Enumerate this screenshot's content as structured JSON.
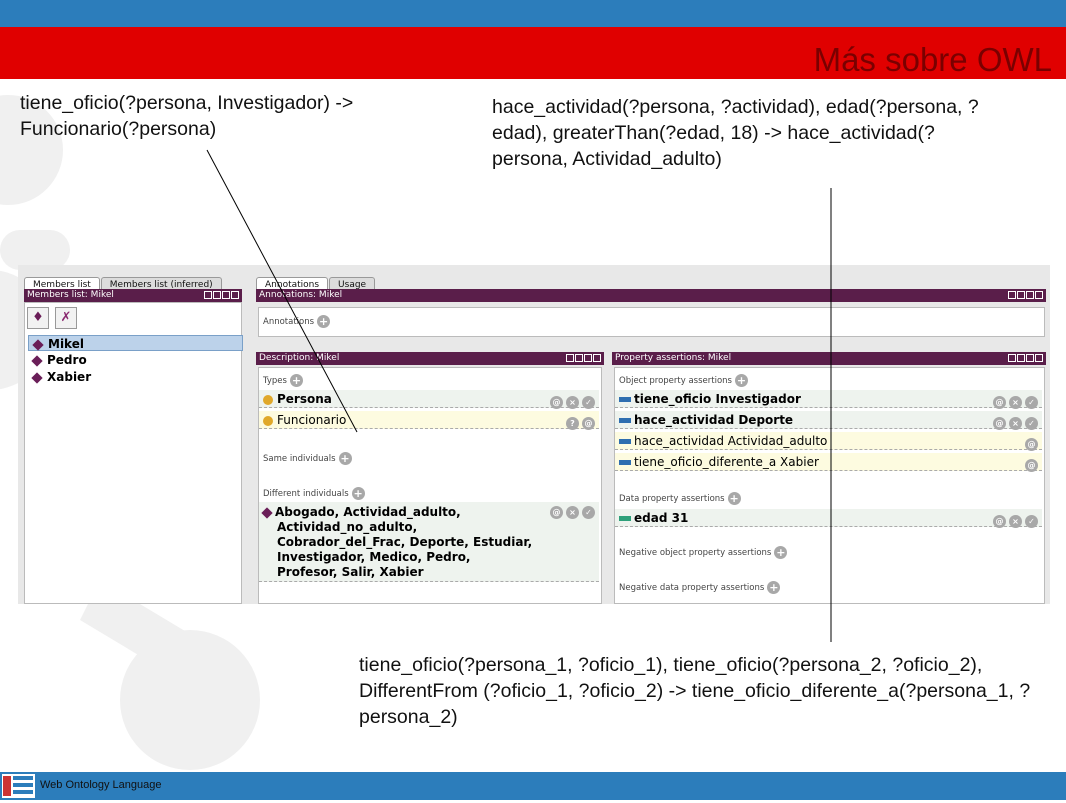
{
  "slide": {
    "title": "Más sobre OWL",
    "footer_text": "Web Ontology Language",
    "annotation_top_left": "tiene_oficio(?persona, Investigador) -> Funcionario(?persona)",
    "annotation_top_right": "hace_actividad(?persona, ?actividad), edad(?persona, ?edad), greaterThan(?edad, 18) -> hace_actividad(?persona, Actividad_adulto)",
    "annotation_bottom": "tiene_oficio(?persona_1, ?oficio_1), tiene_oficio(?persona_2, ?oficio_2),  DifferentFrom (?oficio_1, ?oficio_2) -> tiene_oficio_diferente_a(?persona_1, ?persona_2)"
  },
  "members": {
    "tabs": [
      "Members list",
      "Members list (inferred)"
    ],
    "header": "Members list: Mikel",
    "individuals": [
      "Mikel",
      "Pedro",
      "Xabier"
    ]
  },
  "annotations": {
    "tabs": [
      "Annotations",
      "Usage"
    ],
    "header": "Annotations: Mikel",
    "label": "Annotations"
  },
  "description": {
    "header": "Description: Mikel",
    "types_label": "Types",
    "types": [
      "Persona",
      "Funcionario"
    ],
    "same_label": "Same individuals",
    "different_label": "Different individuals",
    "different_list": [
      "Abogado, Actividad_adulto,",
      "Actividad_no_adulto,",
      "Cobrador_del_Frac, Deporte, Estudiar,",
      "Investigador, Medico, Pedro,",
      "Profesor, Salir, Xabier"
    ]
  },
  "properties": {
    "header": "Property assertions: Mikel",
    "object_label": "Object property assertions",
    "object_assertions": [
      "tiene_oficio  Investigador",
      "hace_actividad  Deporte",
      "hace_actividad  Actividad_adulto",
      "tiene_oficio_diferente_a  Xabier"
    ],
    "data_label": "Data property assertions",
    "data_assertions": [
      "edad  31"
    ],
    "neg_object_label": "Negative object property assertions",
    "neg_data_label": "Negative data property assertions"
  },
  "colors": {
    "top_bar": "#2c7dbb",
    "title_bar": "#e00000",
    "title_text": "#7a0000",
    "panel_header": "#5a1e4a"
  },
  "icons": {
    "add": "+",
    "info": "@",
    "delete": "×",
    "explain": "?",
    "done": "✓"
  }
}
